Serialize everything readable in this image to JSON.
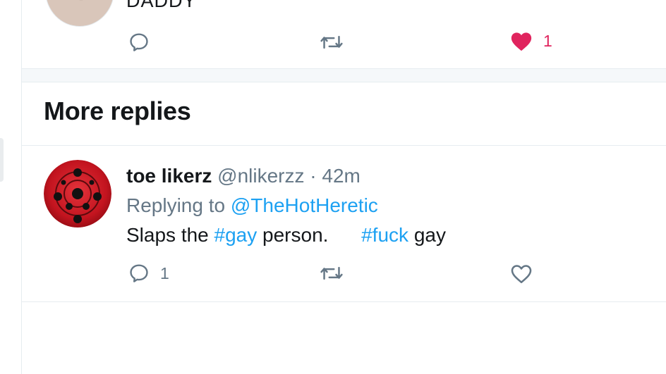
{
  "previous_tweet": {
    "partial_name": "DADDY",
    "actions": {
      "reply_count": "",
      "retweet_count": "",
      "like_count": "1"
    }
  },
  "more_replies": {
    "heading": "More replies"
  },
  "reply": {
    "display_name": "toe likerz",
    "handle": "@nlikerzz",
    "separator": "·",
    "time": "42m",
    "replying_prefix": "Replying to",
    "replying_to": "@TheHotHeretic",
    "text_segments": [
      {
        "text": "Slaps the ",
        "type": "text"
      },
      {
        "text": "#gay",
        "type": "hashtag"
      },
      {
        "text": " person.      ",
        "type": "text"
      },
      {
        "text": "#fuck",
        "type": "hashtag"
      },
      {
        "text": " gay",
        "type": "text"
      }
    ],
    "actions": {
      "reply_count": "1",
      "retweet_count": "",
      "like_count": ""
    }
  },
  "colors": {
    "link": "#1da1f2",
    "muted": "#657786",
    "like_active": "#e0245e",
    "divider": "#e6ecf0"
  }
}
